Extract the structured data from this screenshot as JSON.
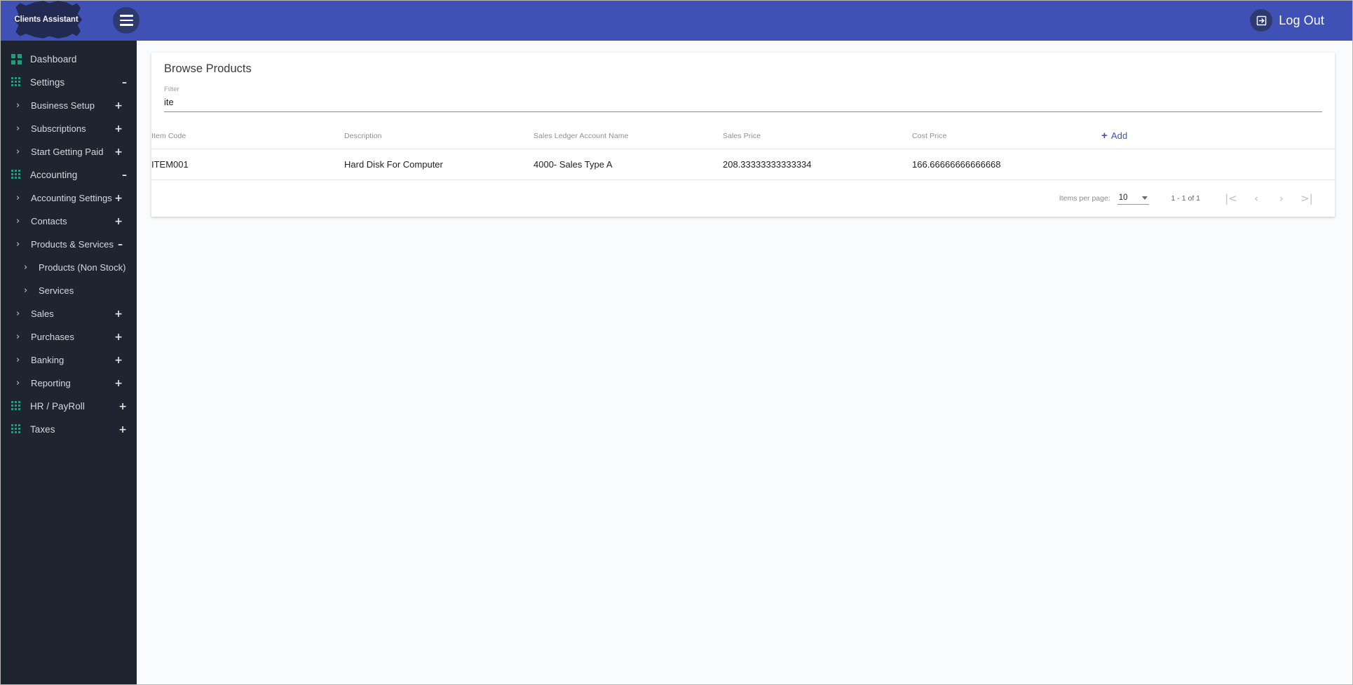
{
  "app": {
    "brand": "Clients Assistant",
    "logout_label": "Log Out",
    "accent_indigo": "#3f51b5",
    "accent_teal": "#1e9e7e",
    "sidebar_bg": "#1e2430"
  },
  "sidebar": {
    "items": [
      {
        "label": "Dashboard",
        "level": 0,
        "icon": "grid-2x2-icon",
        "expander": ""
      },
      {
        "label": "Settings",
        "level": 0,
        "icon": "grid-3x3-icon",
        "expander": "–"
      },
      {
        "label": "Business Setup",
        "level": 1,
        "icon": "chevron-right-icon",
        "expander": "+"
      },
      {
        "label": "Subscriptions",
        "level": 1,
        "icon": "chevron-right-icon",
        "expander": "+"
      },
      {
        "label": "Start Getting Paid",
        "level": 1,
        "icon": "chevron-right-icon",
        "expander": "+"
      },
      {
        "label": "Accounting",
        "level": 0,
        "icon": "grid-3x3-icon",
        "expander": "–"
      },
      {
        "label": "Accounting Settings",
        "level": 1,
        "icon": "chevron-right-icon",
        "expander": "+"
      },
      {
        "label": "Contacts",
        "level": 1,
        "icon": "chevron-right-icon",
        "expander": "+"
      },
      {
        "label": "Products & Services",
        "level": 1,
        "icon": "chevron-right-icon",
        "expander": "–"
      },
      {
        "label": "Products (Non Stock)",
        "level": 2,
        "icon": "chevron-right-icon",
        "expander": ""
      },
      {
        "label": "Services",
        "level": 2,
        "icon": "chevron-right-icon",
        "expander": ""
      },
      {
        "label": "Sales",
        "level": 1,
        "icon": "chevron-right-icon",
        "expander": "+"
      },
      {
        "label": "Purchases",
        "level": 1,
        "icon": "chevron-right-icon",
        "expander": "+"
      },
      {
        "label": "Banking",
        "level": 1,
        "icon": "chevron-right-icon",
        "expander": "+"
      },
      {
        "label": "Reporting",
        "level": 1,
        "icon": "chevron-right-icon",
        "expander": "+"
      },
      {
        "label": "HR / PayRoll",
        "level": 0,
        "icon": "grid-3x3-icon",
        "expander": "+"
      },
      {
        "label": "Taxes",
        "level": 0,
        "icon": "grid-3x3-icon",
        "expander": "+"
      }
    ]
  },
  "page": {
    "title": "Browse Products",
    "filter": {
      "label": "Filter",
      "value": "ite",
      "placeholder": ""
    },
    "table": {
      "columns": [
        "Item Code",
        "Description",
        "Sales Ledger Account Name",
        "Sales Price",
        "Cost Price"
      ],
      "add_label": "Add",
      "add_icon": "plus-icon",
      "rows": [
        {
          "item_code": "ITEM001",
          "description": "Hard Disk For Computer",
          "sales_ledger_account_name": "4000- Sales Type A",
          "sales_price": "208.33333333333334",
          "cost_price": "166.66666666666668"
        }
      ]
    },
    "paginator": {
      "items_per_page_label": "Items per page:",
      "items_per_page_value": "10",
      "range_label": "1 - 1 of 1",
      "first_icon": "|<",
      "prev_icon": "‹",
      "next_icon": "›",
      "last_icon": ">|"
    }
  }
}
